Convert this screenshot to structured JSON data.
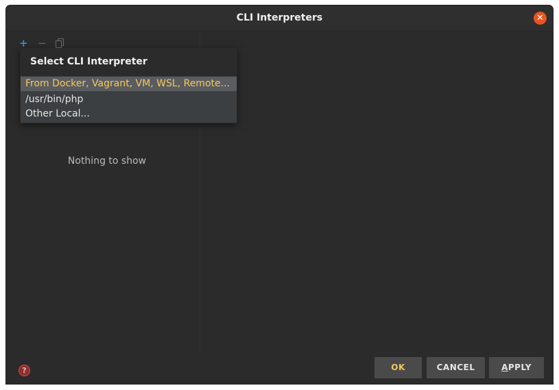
{
  "window": {
    "title": "CLI Interpreters",
    "close_glyph": "✕"
  },
  "toolbar": {
    "add_glyph": "+",
    "remove_glyph": "−"
  },
  "left_panel": {
    "empty_text": "Nothing to show"
  },
  "popup": {
    "title": "Select CLI Interpreter",
    "items": [
      {
        "label": "From Docker, Vagrant, VM, WSL, Remote...",
        "selected": true
      },
      {
        "label": "/usr/bin/php",
        "selected": false
      },
      {
        "label": "Other Local...",
        "selected": false
      }
    ]
  },
  "footer": {
    "help_glyph": "?",
    "ok_label": "OK",
    "cancel_label": "CANCEL",
    "apply_label_first": "A",
    "apply_label_rest": "PPLY"
  },
  "colors": {
    "accent_orange": "#e95420",
    "highlight_yellow": "#f6c85f",
    "add_blue": "#3592c4"
  },
  "icons": {
    "add": "add-icon",
    "remove": "remove-icon",
    "copy": "copy-icon",
    "close": "close-icon",
    "help": "help-icon"
  }
}
